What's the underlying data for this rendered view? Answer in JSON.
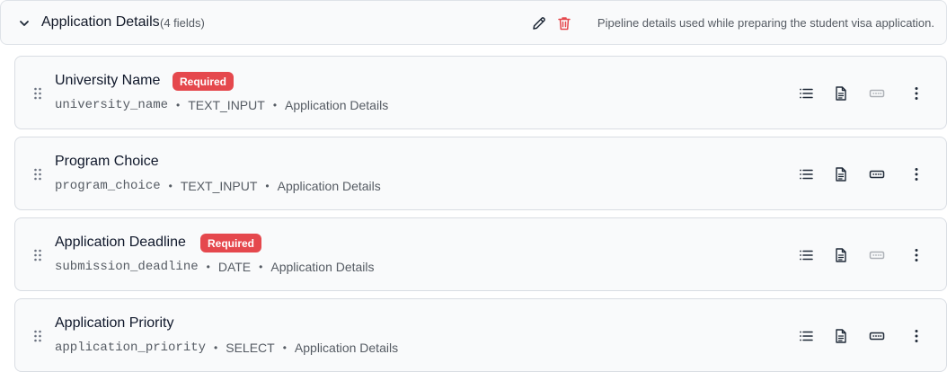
{
  "section": {
    "title": "Application Details",
    "count": "(4 fields)",
    "description": "Pipeline details used while preparing the student visa application."
  },
  "fields": [
    {
      "name": "University Name",
      "required": true,
      "badge": "Required",
      "key": "university_name",
      "type": "TEXT_INPUT",
      "group": "Application Details",
      "input_icon_active": false
    },
    {
      "name": "Program Choice",
      "required": false,
      "badge": "",
      "key": "program_choice",
      "type": "TEXT_INPUT",
      "group": "Application Details",
      "input_icon_active": true
    },
    {
      "name": "Application Deadline",
      "required": true,
      "badge": "Required",
      "key": "submission_deadline",
      "type": "DATE",
      "group": "Application Details",
      "input_icon_active": false
    },
    {
      "name": "Application Priority",
      "required": false,
      "badge": "",
      "key": "application_priority",
      "type": "SELECT",
      "group": "Application Details",
      "input_icon_active": true
    }
  ],
  "meta_separator": "•",
  "colors": {
    "required_badge": "#e5484d",
    "delete_icon": "#e5484d"
  },
  "icons": {
    "collapse": "chevron-down-icon",
    "edit": "pencil-icon",
    "delete": "trash-icon",
    "drag": "drag-handle-icon",
    "list": "list-icon",
    "document": "document-icon",
    "input": "text-input-icon",
    "more": "more-vertical-icon"
  }
}
